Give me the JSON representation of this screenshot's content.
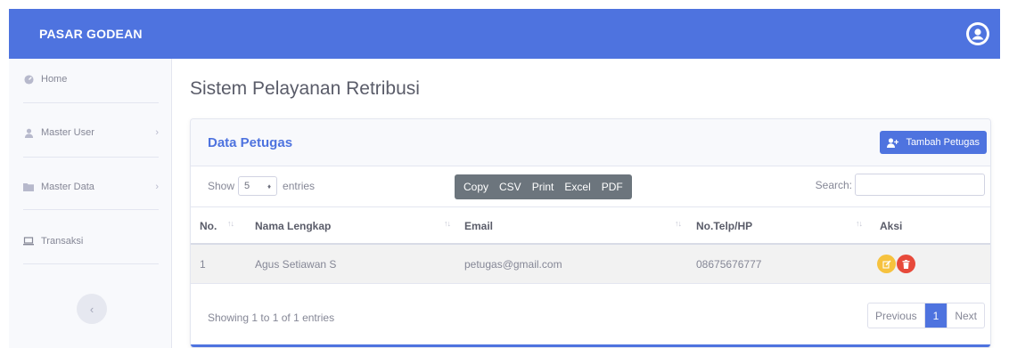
{
  "topbar": {
    "brand": "PASAR GODEAN",
    "accent": "#4e73df"
  },
  "sidebar": {
    "items": [
      {
        "label": "Home",
        "icon": "dashboard-icon"
      },
      {
        "label": "Master User",
        "icon": "user-icon"
      },
      {
        "label": "Master Data",
        "icon": "folder-icon"
      },
      {
        "label": "Transaksi",
        "icon": "laptop-icon"
      }
    ]
  },
  "page": {
    "title": "Sistem Pelayanan Retribusi"
  },
  "card": {
    "title": "Data Petugas",
    "add_button": "Tambah Petugas"
  },
  "table_controls": {
    "show_label": "Show",
    "entries_value": "5",
    "entries_label": "entries",
    "export_buttons": [
      "Copy",
      "CSV",
      "Print",
      "Excel",
      "PDF"
    ],
    "search_label": "Search:"
  },
  "table": {
    "columns": [
      "No.",
      "Nama Lengkap",
      "Email",
      "No.Telp/HP",
      "Aksi"
    ],
    "rows": [
      {
        "no": "1",
        "nama": "Agus Setiawan S",
        "email": "petugas@gmail.com",
        "telp": "08675676777"
      }
    ]
  },
  "footer": {
    "info": "Showing 1 to 1 of 1 entries",
    "prev": "Previous",
    "page": "1",
    "next": "Next"
  }
}
